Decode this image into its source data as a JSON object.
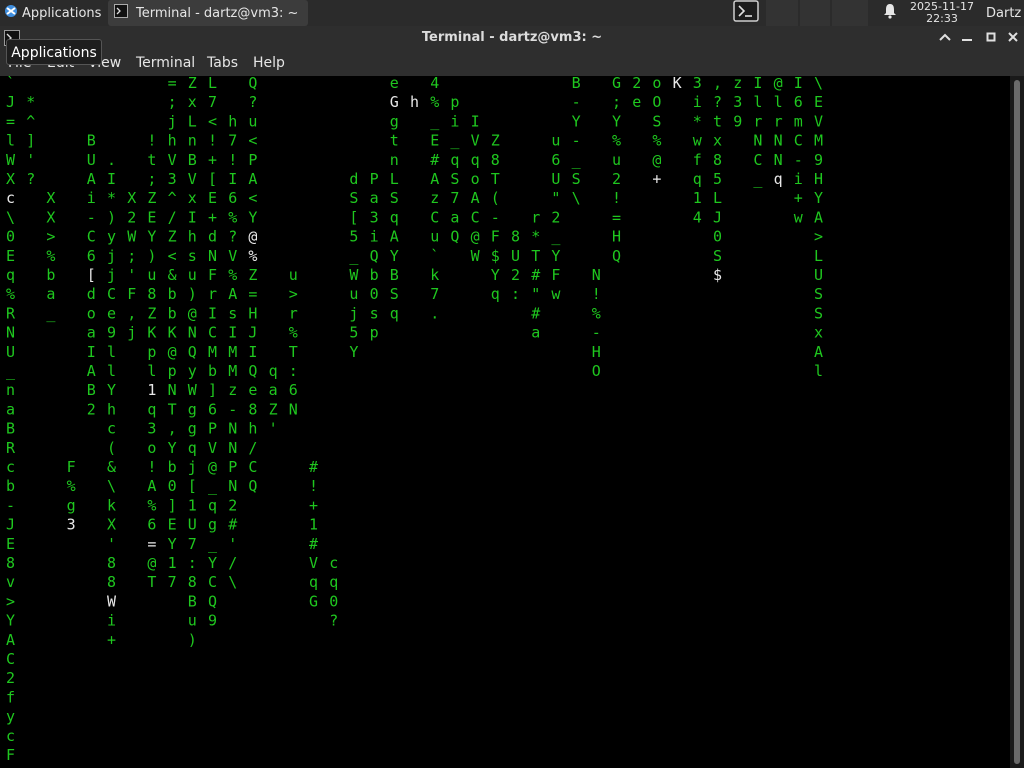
{
  "panel": {
    "applications_label": "Applications",
    "task_label": "Terminal - dartz@vm3: ~",
    "date": "2025-11-17",
    "time": "22:33",
    "user": "Dartz"
  },
  "tooltip": "Applications",
  "window": {
    "title": "Terminal - dartz@vm3: ~",
    "menu": [
      "File",
      "Edit",
      "View",
      "Terminal",
      "Tabs",
      "Help"
    ]
  },
  "terminal": {
    "program": "cmatrix",
    "colors": {
      "rain": "#1fc71f",
      "head": "#e8e8e8",
      "background": "#000000"
    },
    "columns": [
      {
        "col": 0,
        "chars": "`J=lWXc\\0Eq%RNU_naBRcb-JE8v>YAC2fycF",
        "heads": [
          6
        ]
      },
      {
        "col": 1,
        "chars": "*^]'?",
        "heads": []
      },
      {
        "col": 2,
        "chars": "XX>%ba_",
        "heads": []
      },
      {
        "col": 3,
        "chars": "F%g3",
        "heads": [
          3
        ]
      },
      {
        "col": 4,
        "chars": "BUAi-C6[doaIAB2",
        "heads": [
          7
        ]
      },
      {
        "col": 5,
        "chars": ".I*)yjjCe9llYhc(&\\kX'88Wi+",
        "heads": [
          23
        ]
      },
      {
        "col": 6,
        "chars": "X2W;'F,j",
        "heads": []
      },
      {
        "col": 7,
        "chars": "!t;ZEY)u8ZKpl1q3o!A%6=@T",
        "heads": [
          13,
          21
        ]
      },
      {
        "col": 8,
        "chars": "=;jhV3^/Z<&bbK@pNT,Yb0]EY17",
        "heads": []
      },
      {
        "col": 9,
        "chars": "ZxLnBVxIhsu)@NQyWggqj[1U7:8Bu)",
        "heads": []
      },
      {
        "col": 10,
        "chars": "L7<!+[E+dNFrICMb]6PV@_qg_YCQ9",
        "heads": []
      },
      {
        "col": 11,
        "chars": "h7!I6%?V%AsIMMz-NNPN2#'/\\",
        "heads": []
      },
      {
        "col": 12,
        "chars": "Q?u<PA<Y@%Z=HJIQe8h/CQ",
        "heads": [
          8,
          9
        ]
      },
      {
        "col": 13,
        "chars": "qaZ'",
        "heads": [
          19
        ]
      },
      {
        "col": 14,
        "chars": "u>r%T:6N",
        "heads": []
      },
      {
        "col": 15,
        "chars": "#!+1#VqG",
        "heads": []
      },
      {
        "col": 16,
        "chars": "cq0?",
        "heads": []
      },
      {
        "col": 17,
        "chars": "dS[5_Wuj5Y",
        "heads": []
      },
      {
        "col": 18,
        "chars": "Pa3iQb0sp",
        "heads": []
      },
      {
        "col": 19,
        "chars": "eGgtnLSqAYBSq",
        "heads": [
          1
        ]
      },
      {
        "col": 20,
        "chars": "h",
        "heads": [
          0
        ]
      },
      {
        "col": 21,
        "chars": "4%_E#AzCu`k7.",
        "heads": []
      },
      {
        "col": 22,
        "chars": "pi_qS7aQ",
        "heads": []
      },
      {
        "col": 23,
        "chars": "IVqoAC@W",
        "heads": []
      },
      {
        "col": 24,
        "chars": "Z8T(-F$Yq",
        "heads": []
      },
      {
        "col": 25,
        "chars": "8U2:",
        "heads": []
      },
      {
        "col": 26,
        "chars": "r*T#\"#a",
        "heads": []
      },
      {
        "col": 27,
        "chars": "u6U\"2_YFw",
        "heads": []
      },
      {
        "col": 28,
        "chars": "B-Y-_S\\",
        "heads": []
      },
      {
        "col": 29,
        "chars": "N!%-HO",
        "heads": []
      },
      {
        "col": 30,
        "chars": "G;Y%u2!=HQ",
        "heads": []
      },
      {
        "col": 31,
        "chars": "2e",
        "heads": [
          2
        ]
      },
      {
        "col": 32,
        "chars": "oOS%@+",
        "heads": [
          5
        ]
      },
      {
        "col": 33,
        "chars": "K",
        "heads": [
          0
        ]
      },
      {
        "col": 34,
        "chars": "3i*wfq14",
        "heads": []
      },
      {
        "col": 35,
        "chars": ",?tx85LJ0S$",
        "heads": [
          10
        ]
      },
      {
        "col": 36,
        "chars": "z39",
        "heads": []
      },
      {
        "col": 37,
        "chars": "IlrNC_",
        "heads": []
      },
      {
        "col": 38,
        "chars": "@lrNNq",
        "heads": [
          5
        ]
      },
      {
        "col": 39,
        "chars": "I6mC-i+w",
        "heads": []
      },
      {
        "col": 40,
        "chars": "\\EVM9HYA>LUSSxAl",
        "heads": []
      }
    ]
  }
}
